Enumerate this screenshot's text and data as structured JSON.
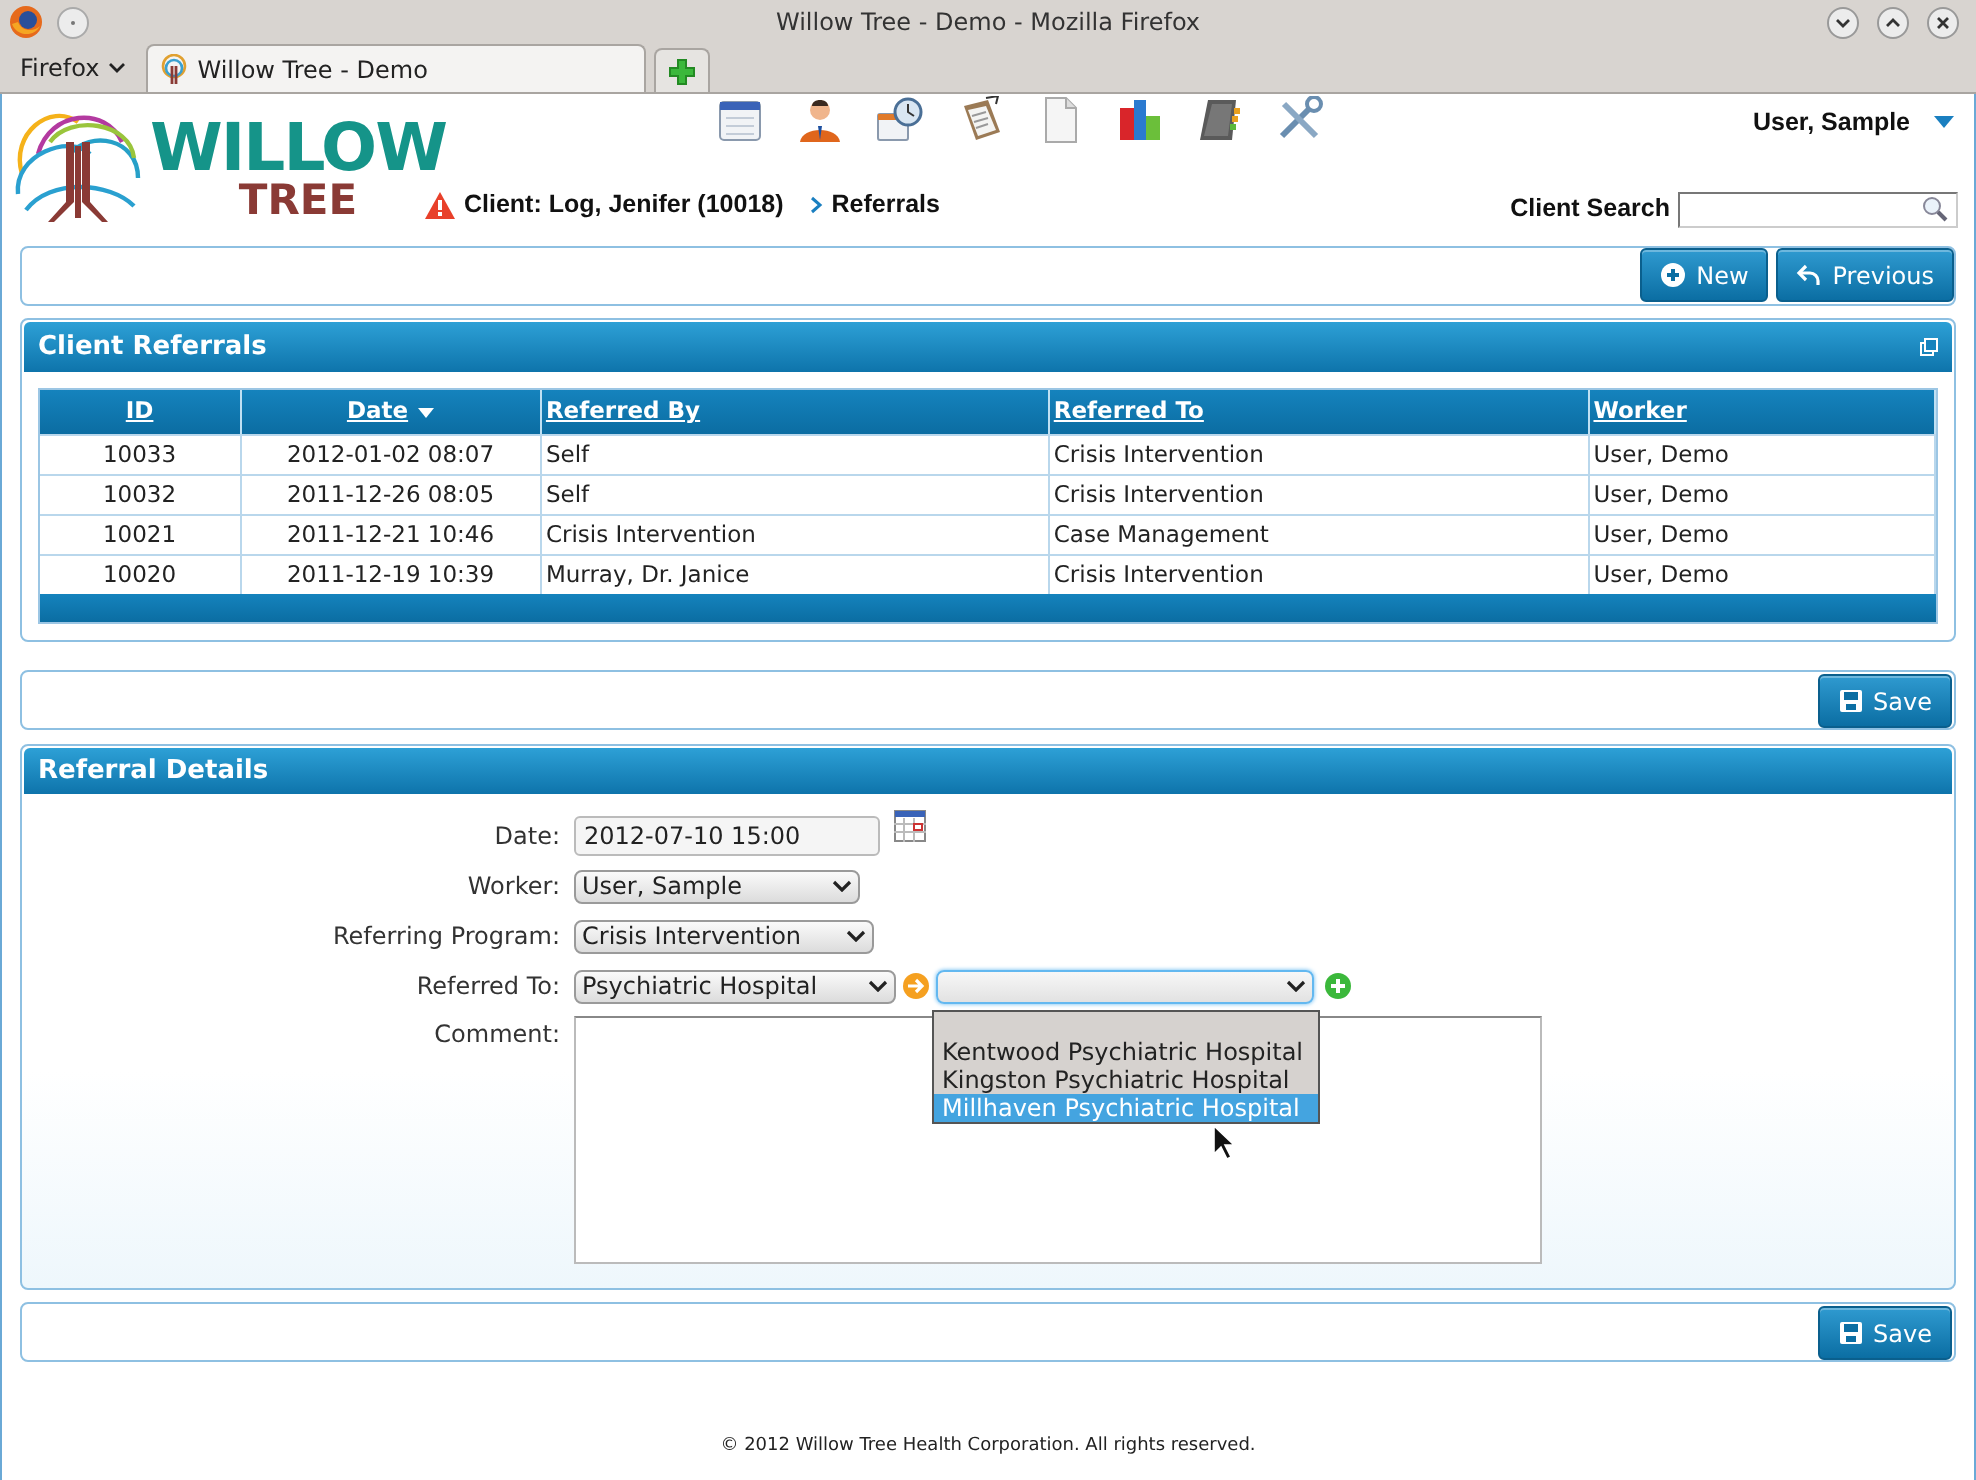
{
  "window": {
    "title": "Willow Tree - Demo - Mozilla Firefox"
  },
  "browser": {
    "menu": "Firefox",
    "tabs": [
      {
        "label": "Willow Tree - Demo",
        "selected": true
      }
    ]
  },
  "logo": {
    "line_1": "WILLOW",
    "line_2": "TREE"
  },
  "user_menu": "User, Sample",
  "client_alert": "Client: Log, Jenifer (10018)",
  "breadcrumb": "Referrals",
  "client_search": {
    "label": "Client Search"
  },
  "toolbar": {
    "buttons": [
      {
        "label": "New",
        "kind": "new"
      },
      {
        "label": "Previous",
        "kind": "back"
      }
    ]
  },
  "referrals": {
    "title": "Client Referrals",
    "columns": [
      {
        "label": "ID",
        "sorted": false
      },
      {
        "label": "Date",
        "sorted": true
      },
      {
        "label": "Referred By",
        "sorted": false
      },
      {
        "label": "Referred To",
        "sorted": false
      },
      {
        "label": "Worker",
        "sorted": false
      }
    ],
    "rows": [
      [
        "10033",
        "2012-01-02 08:07",
        "Self",
        "Crisis Intervention",
        "User, Demo"
      ],
      [
        "10032",
        "2011-12-26 08:05",
        "Self",
        "Crisis Intervention",
        "User, Demo"
      ],
      [
        "10021",
        "2011-12-21 10:46",
        "Crisis Intervention",
        "Case Management",
        "User, Demo"
      ],
      [
        "10020",
        "2011-12-19 10:39",
        "Murray, Dr. Janice",
        "Crisis Intervention",
        "User, Demo"
      ]
    ]
  },
  "save_bar_top": {
    "button": "Save"
  },
  "details": {
    "title": "Referral Details",
    "fields": [
      {
        "kind": "date",
        "label": "Date:",
        "value": "2012-07-10 15:00"
      },
      {
        "kind": "select",
        "label": "Worker:",
        "value": "User, Sample"
      },
      {
        "kind": "select",
        "label": "Referring Program:",
        "value": "Crisis Intervention"
      },
      {
        "kind": "select-pair",
        "label": "Referred To:",
        "value": "Psychiatric Hospital",
        "dropdown": {
          "expanded": true,
          "options": [
            {
              "label": "Kentwood Psychiatric Hospital",
              "selected": false
            },
            {
              "label": "Kingston Psychiatric Hospital",
              "selected": false
            },
            {
              "label": "Millhaven Psychiatric Hospital",
              "selected": true
            }
          ]
        }
      },
      {
        "kind": "textarea",
        "label": "Comment:"
      }
    ]
  },
  "save_bar_bottom": {
    "button": "Save"
  },
  "footer": "© 2012 Willow Tree Health Corporation. All rights reserved."
}
